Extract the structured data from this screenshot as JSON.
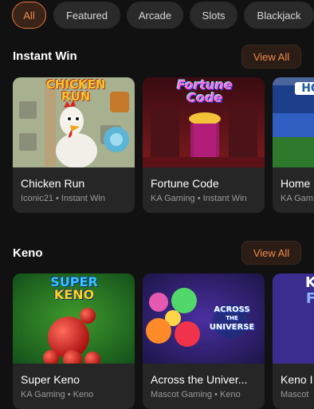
{
  "tabs": [
    {
      "label": "All",
      "active": true
    },
    {
      "label": "Featured",
      "active": false
    },
    {
      "label": "Arcade",
      "active": false
    },
    {
      "label": "Slots",
      "active": false
    },
    {
      "label": "Blackjack",
      "active": false
    }
  ],
  "sections": [
    {
      "title": "Instant Win",
      "view_all": "View All",
      "games": [
        {
          "title": "Chicken Run",
          "subtitle": "Iconic21 • Instant Win",
          "art_text": [
            "CHICKEN",
            "RUN"
          ]
        },
        {
          "title": "Fortune Code",
          "subtitle": "KA Gaming • Instant Win",
          "art_text": [
            "Fortune",
            "Code"
          ]
        },
        {
          "title": "Home",
          "subtitle": "KA Gam",
          "art_text": [
            "HO"
          ]
        }
      ]
    },
    {
      "title": "Keno",
      "view_all": "View All",
      "games": [
        {
          "title": "Super Keno",
          "subtitle": "KA Gaming • Keno",
          "art_text": [
            "SUPER",
            "KENO"
          ]
        },
        {
          "title": "Across the Univer...",
          "subtitle": "Mascot Gaming • Keno",
          "art_text": [
            "ACROSS",
            "THE",
            "UNIVERSE"
          ]
        },
        {
          "title": "Keno I",
          "subtitle": "Mascot",
          "art_text": [
            "K",
            "F"
          ]
        }
      ]
    }
  ]
}
